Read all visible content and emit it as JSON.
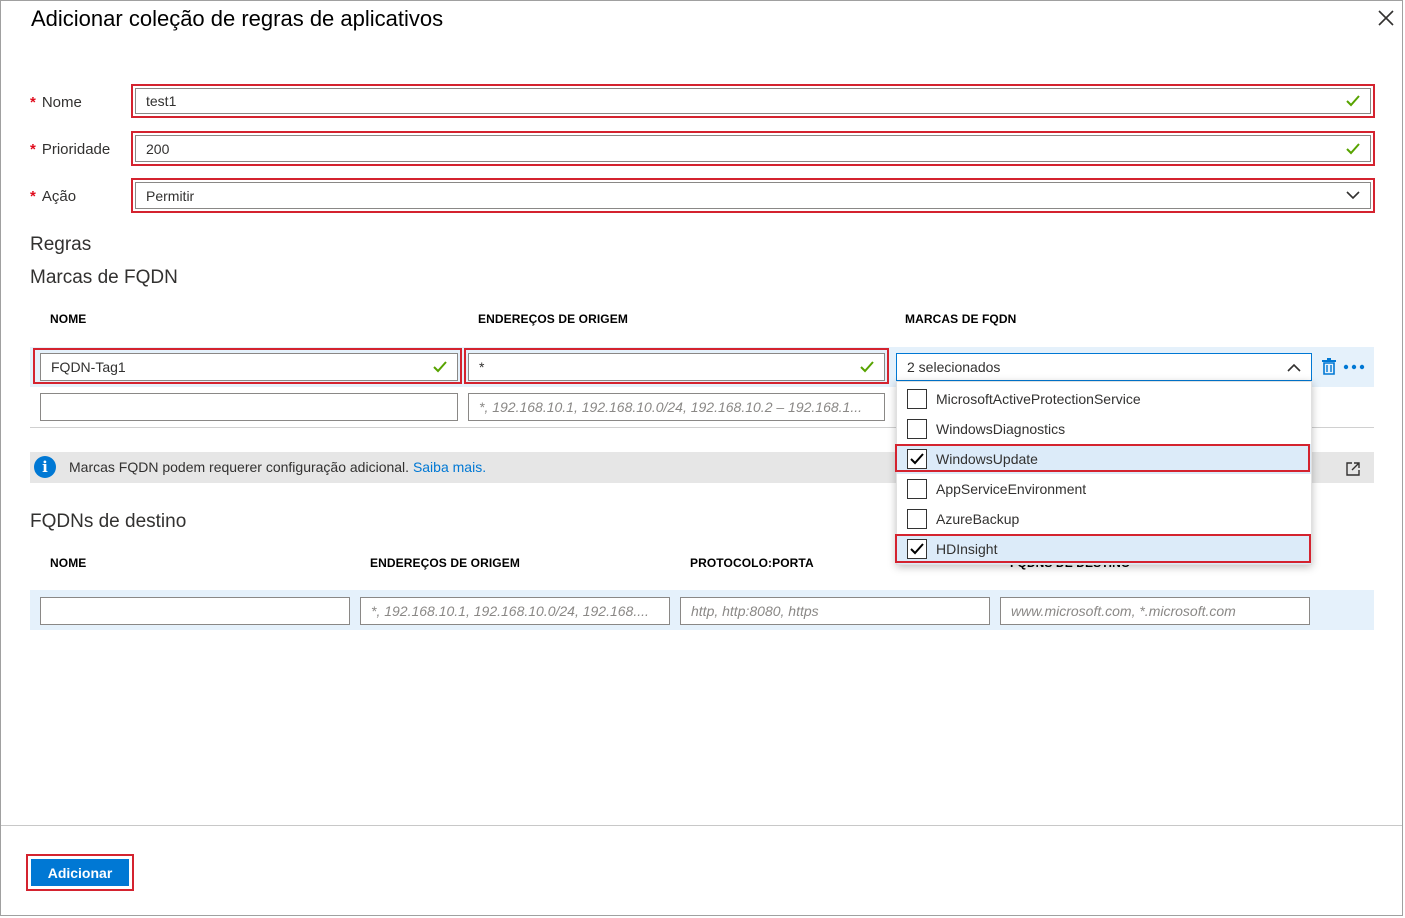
{
  "dialog": {
    "title": "Adicionar coleção de regras de aplicativos"
  },
  "form": {
    "name_label": "Nome",
    "name_value": "test1",
    "priority_label": "Prioridade",
    "priority_value": "200",
    "action_label": "Ação",
    "action_value": "Permitir",
    "required_mark": "*"
  },
  "rules": {
    "heading": "Regras",
    "fqdn_tags": {
      "heading": "Marcas de FQDN",
      "columns": [
        "NOME",
        "ENDEREÇOS DE ORIGEM",
        "MARCAS DE FQDN"
      ],
      "row1": {
        "name": "FQDN-Tag1",
        "source": "*",
        "tags_summary": "2 selecionados"
      },
      "row2": {
        "source_placeholder": "*, 192.168.10.1, 192.168.10.0/24, 192.168.10.2 – 192.168.1..."
      },
      "options": [
        {
          "label": "MicrosoftActiveProtectionService",
          "checked": false
        },
        {
          "label": "WindowsDiagnostics",
          "checked": false
        },
        {
          "label": "WindowsUpdate",
          "checked": true
        },
        {
          "label": "AppServiceEnvironment",
          "checked": false
        },
        {
          "label": "AzureBackup",
          "checked": false
        },
        {
          "label": "HDInsight",
          "checked": true
        }
      ]
    },
    "info": {
      "text": "Marcas FQDN podem requerer configuração adicional.",
      "link": "Saiba mais."
    },
    "target_fqdns": {
      "heading": "FQDNs de destino",
      "columns": [
        "NOME",
        "ENDEREÇOS DE ORIGEM",
        "PROTOCOLO:PORTA",
        "FQDNS DE DESTINO"
      ],
      "placeholders": {
        "source": "*, 192.168.10.1, 192.168.10.0/24, 192.168....",
        "protocol": "http, http:8080, https",
        "target": "www.microsoft.com, *.microsoft.com"
      }
    }
  },
  "footer": {
    "add_button": "Adicionar"
  },
  "colors": {
    "accent": "#0078d4",
    "highlight": "#d4232f",
    "valid_check": "#57a300",
    "row_selected": "#e5f1fb"
  },
  "icons": [
    "close-icon",
    "check-icon",
    "chevron-down-icon",
    "chevron-up-icon",
    "delete-icon",
    "more-icon",
    "info-icon",
    "external-link-icon",
    "checkbox-checked-icon"
  ]
}
